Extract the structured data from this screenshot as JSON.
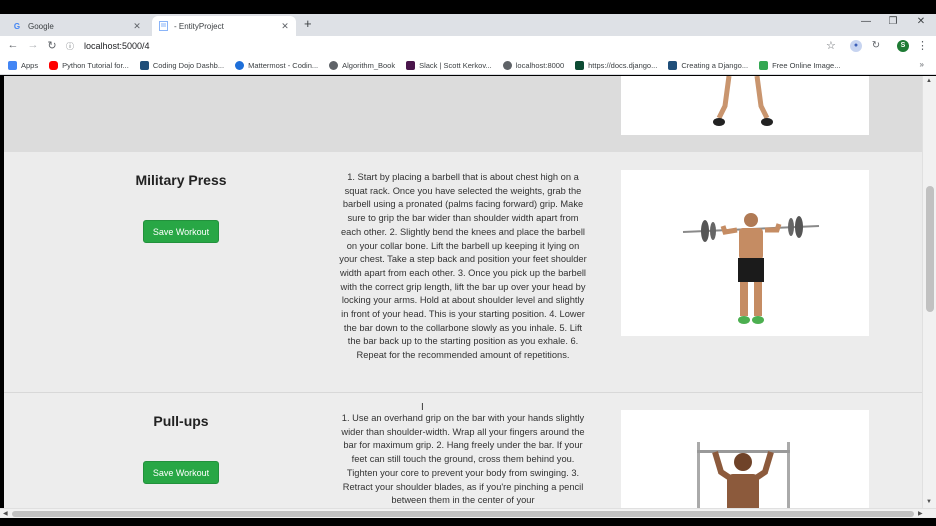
{
  "browser": {
    "tabs": [
      {
        "title": "Google",
        "favicon": "google-g-icon",
        "active": false
      },
      {
        "title": "- EntityProject",
        "favicon": "page-icon",
        "active": true
      }
    ],
    "new_tab": "+",
    "url": "localhost:5000/4",
    "profile_initial": "S"
  },
  "bookmarks": [
    {
      "label": "Apps",
      "icon": "apps-grid-icon",
      "color": "#4285f4"
    },
    {
      "label": "Python Tutorial for...",
      "icon": "youtube-icon",
      "color": "#ff0000"
    },
    {
      "label": "Coding Dojo Dashb...",
      "icon": "coding-dojo-icon",
      "color": "#1f4e79"
    },
    {
      "label": "Mattermost - Codin...",
      "icon": "mattermost-icon",
      "color": "#1e6fd9"
    },
    {
      "label": "Algorithm_Book",
      "icon": "globe-icon",
      "color": "#5f6368"
    },
    {
      "label": "Slack | Scott Kerkov...",
      "icon": "slack-icon",
      "color": "#4a154b"
    },
    {
      "label": "localhost:8000",
      "icon": "globe-icon",
      "color": "#5f6368"
    },
    {
      "label": "https://docs.django...",
      "icon": "django-icon",
      "color": "#0c4b33"
    },
    {
      "label": "Creating a Django...",
      "icon": "coding-dojo-icon",
      "color": "#1f4e79"
    },
    {
      "label": "Free Online Image...",
      "icon": "image-icon",
      "color": "#34a853"
    }
  ],
  "bookmarks_more": "»",
  "workouts": [
    {
      "name": "",
      "save_label": "",
      "description": ""
    },
    {
      "name": "Military Press",
      "save_label": "Save Workout",
      "description": "1. Start by placing a barbell that is about chest high on a squat rack. Once you have selected the weights, grab the barbell using a pronated (palms facing forward) grip. Make sure to grip the bar wider than shoulder width apart from each other. 2. Slightly bend the knees and place the barbell on your collar bone. Lift the barbell up keeping it lying on your chest. Take a step back and position your feet shoulder width apart from each other. 3. Once you pick up the barbell with the correct grip length, lift the bar up over your head by locking your arms. Hold at about shoulder level and slightly in front of your head. This is your starting position. 4. Lower the bar down to the collarbone slowly as you inhale. 5. Lift the bar back up to the starting position as you exhale. 6. Repeat for the recommended amount of repetitions."
    },
    {
      "name": "Pull-ups",
      "save_label": "Save Workout",
      "description": "1. Use an overhand grip on the bar with your hands slightly wider than shoulder-width. Wrap all your fingers around the bar for maximum grip. 2. Hang freely under the bar. If your feet can still touch the ground, cross them behind you. Tighten your core to prevent your body from swinging. 3. Retract your shoulder blades, as if you're pinching a pencil between them in the center of your"
    }
  ],
  "colors": {
    "save_button": "#28a745",
    "page_background": "#ececec"
  }
}
